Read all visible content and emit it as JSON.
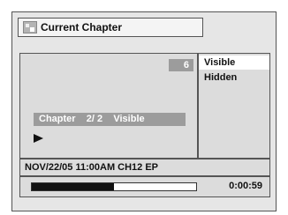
{
  "title": "Current Chapter",
  "preview": {
    "number": "6",
    "chapter_line": "Chapter    2/ 2    Visible"
  },
  "options": [
    "Visible",
    "Hidden"
  ],
  "info": "NOV/22/05 11:00AM CH12 EP",
  "progress": {
    "fraction": 0.5
  },
  "time": "0:00:59",
  "icons": [
    "chapter-icon",
    "play-icon"
  ]
}
